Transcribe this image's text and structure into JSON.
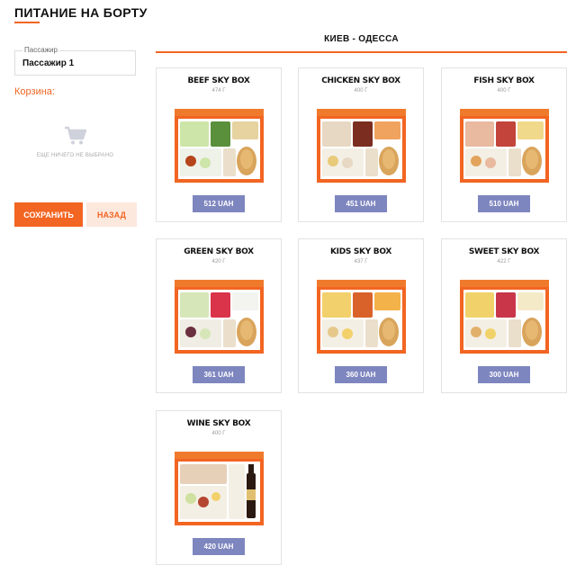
{
  "page": {
    "title": "ПИТАНИЕ НА БОРТУ"
  },
  "passenger": {
    "label": "Пассажир",
    "value": "Пассажир 1"
  },
  "cart": {
    "title": "Корзина:",
    "empty_text": "ЕЩЕ НИЧЕГО НЕ ВЫБРАНО"
  },
  "buttons": {
    "save_label": "СОХРАНИТЬ",
    "back_label": "НАЗАД"
  },
  "route": {
    "title": "КИЕВ - ОДЕССА"
  },
  "colors": {
    "accent": "#f26522",
    "price_button": "#7e86bf",
    "border": "#e3e3e3"
  },
  "meals": [
    {
      "name": "BEEF SKY BOX",
      "weight": "474 Г",
      "price": "512 UAH"
    },
    {
      "name": "CHICKEN SKY BOX",
      "weight": "400 Г",
      "price": "451 UAH"
    },
    {
      "name": "FISH SKY BOX",
      "weight": "400 Г",
      "price": "510 UAH"
    },
    {
      "name": "GREEN SKY BOX",
      "weight": "420 Г",
      "price": "361 UAH"
    },
    {
      "name": "KIDS SKY BOX",
      "weight": "437 Г",
      "price": "360 UAH"
    },
    {
      "name": "SWEET SKY BOX",
      "weight": "422 Г",
      "price": "300 UAH"
    },
    {
      "name": "WINE SKY BOX",
      "weight": "400 Г",
      "price": "420 UAH"
    }
  ]
}
